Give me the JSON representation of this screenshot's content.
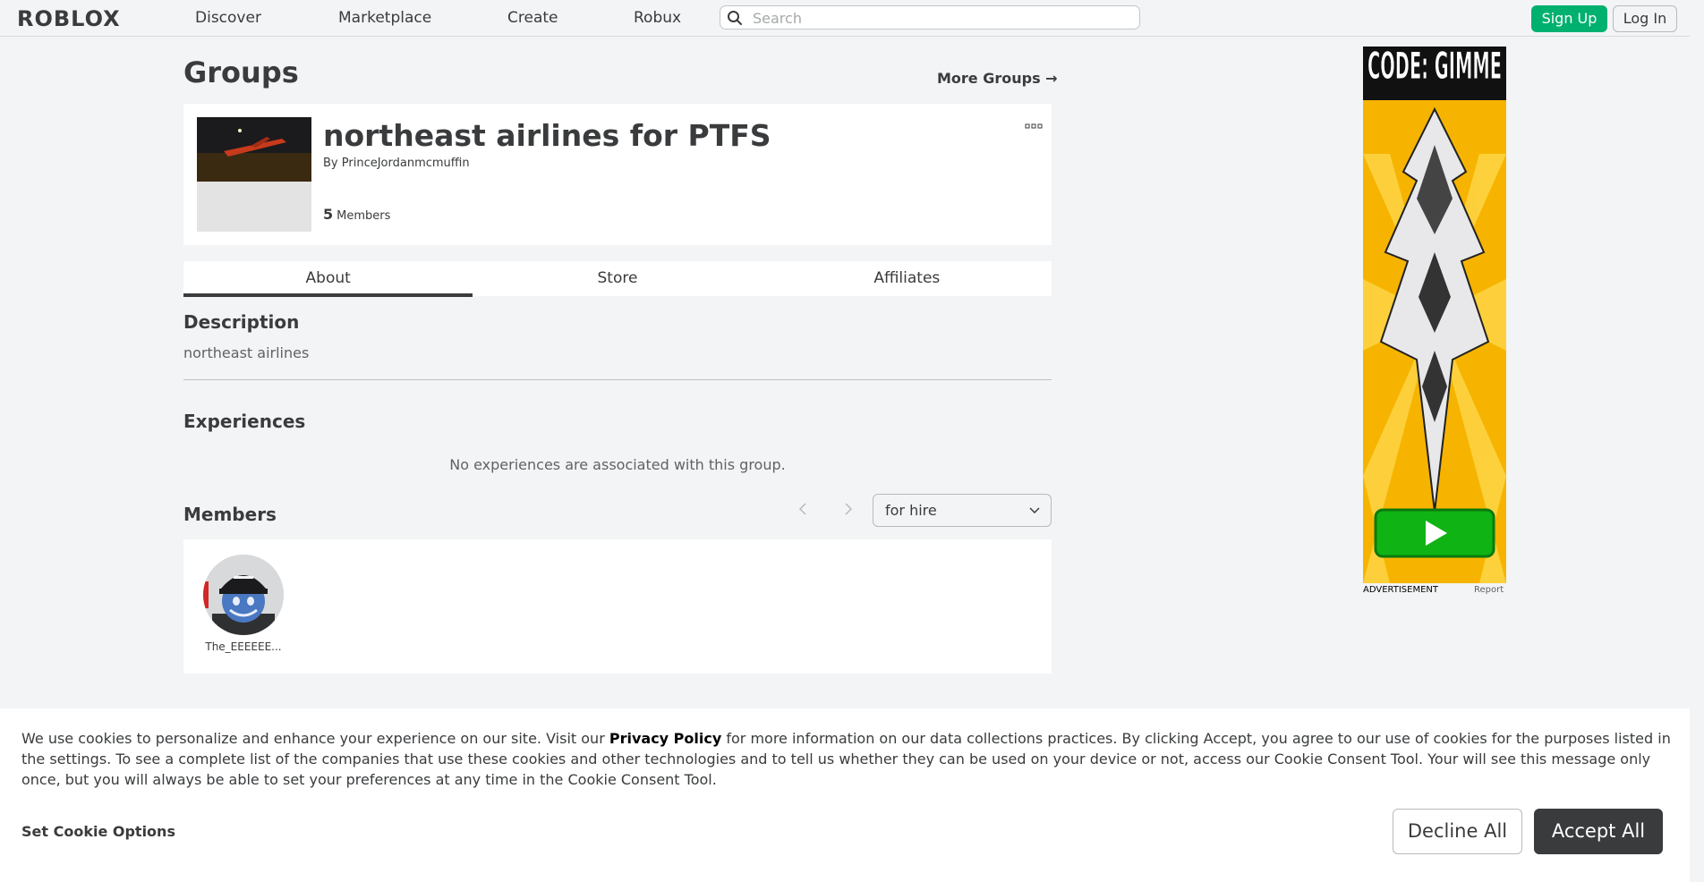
{
  "nav": {
    "logo": "ROBLOX",
    "links": [
      "Discover",
      "Marketplace",
      "Create",
      "Robux"
    ],
    "search_placeholder": "Search",
    "signup": "Sign Up",
    "login": "Log In"
  },
  "page": {
    "title": "Groups",
    "more_groups": "More Groups →"
  },
  "group": {
    "name": "northeast airlines for PTFS",
    "by_label": "By",
    "owner": "PrinceJordanmcmuffin",
    "member_count": "5",
    "member_label": "Members"
  },
  "tabs": [
    {
      "label": "About",
      "active": true
    },
    {
      "label": "Store",
      "active": false
    },
    {
      "label": "Affiliates",
      "active": false
    }
  ],
  "about": {
    "description_heading": "Description",
    "description": "northeast airlines",
    "experiences_heading": "Experiences",
    "experiences_empty": "No experiences are associated with this group.",
    "members_heading": "Members",
    "role_filter": "for hire",
    "members": [
      {
        "name": "The_EEEEEE..."
      }
    ]
  },
  "ad": {
    "headline": "CODE: GIMME",
    "label": "ADVERTISEMENT",
    "report": "Report"
  },
  "cookie": {
    "text_before": "We use cookies to personalize and enhance your experience on our site. Visit our ",
    "privacy_link": "Privacy Policy",
    "text_after": " for more information on our data collections practices. By clicking Accept, you agree to our use of cookies for the purposes listed in the settings. To see a complete list of the companies that use these cookies and other technologies and to tell us whether they can be used on your device or not, access our Cookie Consent Tool. Your will see this message only once, but you will always be able to set your preferences at any time in the Cookie Consent Tool.",
    "options": "Set Cookie Options",
    "decline": "Decline All",
    "accept": "Accept All"
  },
  "colors": {
    "accent_green": "#00b06f",
    "text_primary": "#393b3d",
    "background": "#f2f4f5"
  }
}
